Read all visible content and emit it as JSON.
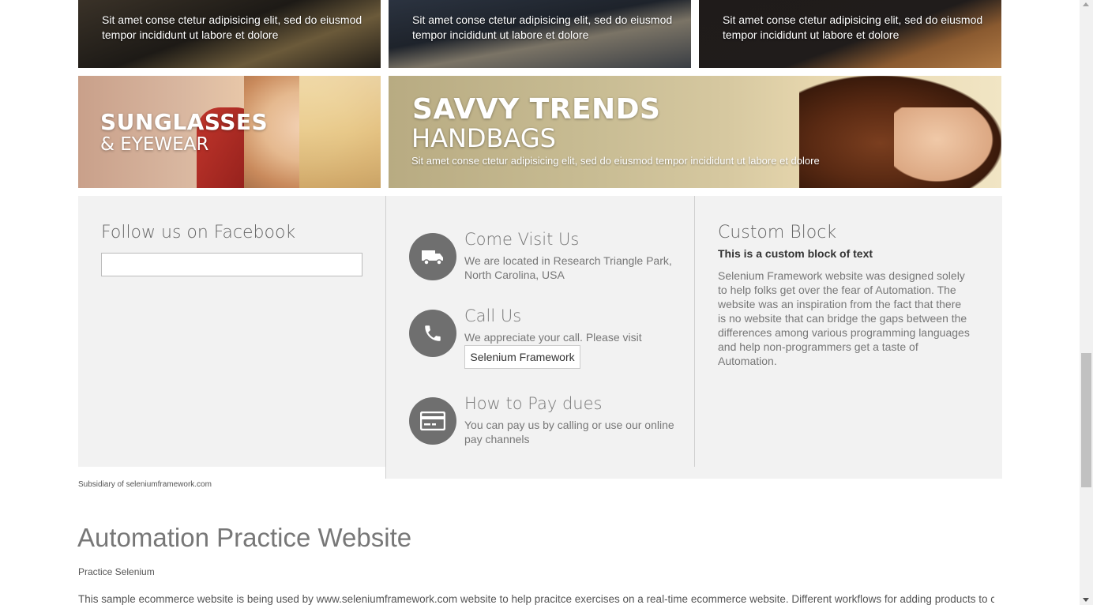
{
  "top_tiles": [
    {
      "text": "Sit amet conse ctetur adipisicing elit, sed do eiusmod tempor incididunt ut labore et dolore"
    },
    {
      "text": "Sit amet conse ctetur adipisicing elit, sed do eiusmod tempor incididunt ut labore et dolore"
    },
    {
      "text": "Sit amet conse ctetur adipisicing elit, sed do eiusmod tempor incididunt ut labore et dolore"
    }
  ],
  "banners": {
    "sunglasses": {
      "line1": "SUNGLASSES",
      "line2": "& EYEWEAR"
    },
    "savvy": {
      "line1": "SAVVY TRENDS",
      "line2": "HANDBAGS",
      "text": "Sit amet conse ctetur adipisicing elit, sed do eiusmod tempor incididunt ut labore et dolore"
    }
  },
  "footer": {
    "facebook": {
      "title": "Follow us on Facebook"
    },
    "visit": {
      "title": "Come Visit Us",
      "text": "We are located in Research Triangle Park, North Carolina, USA",
      "icon": "truck-icon"
    },
    "call": {
      "title": "Call Us",
      "text": "We appreciate your call. Please visit",
      "button": "Selenium Framework",
      "icon": "phone-icon"
    },
    "pay": {
      "title": "How to Pay dues",
      "text": "You can pay us by calling or use our online pay channels",
      "icon": "credit-card-icon"
    },
    "custom": {
      "title": "Custom Block",
      "subtitle": "This is a custom block of text",
      "text": "Selenium Framework website was designed solely to help folks get over the fear of Automation. The website was an inspiration from the fact that there is no website that can bridge the gaps between the differences among various programming languages and help non-programmers get a taste of Automation."
    }
  },
  "subsidiary": "Subsidiary of seleniumframework.com",
  "site": {
    "title": "Automation Practice Website",
    "subtitle": "Practice Selenium",
    "description": "This sample ecommerce website is being used by www.seleniumframework.com website to help pracitce exercises on a real-time ecommerce website. Different workflows for adding products to cart,"
  },
  "colors": {
    "icon_circle": "#6f6f6f",
    "footer_bg": "#f2f2f2",
    "heading": "#666666"
  }
}
